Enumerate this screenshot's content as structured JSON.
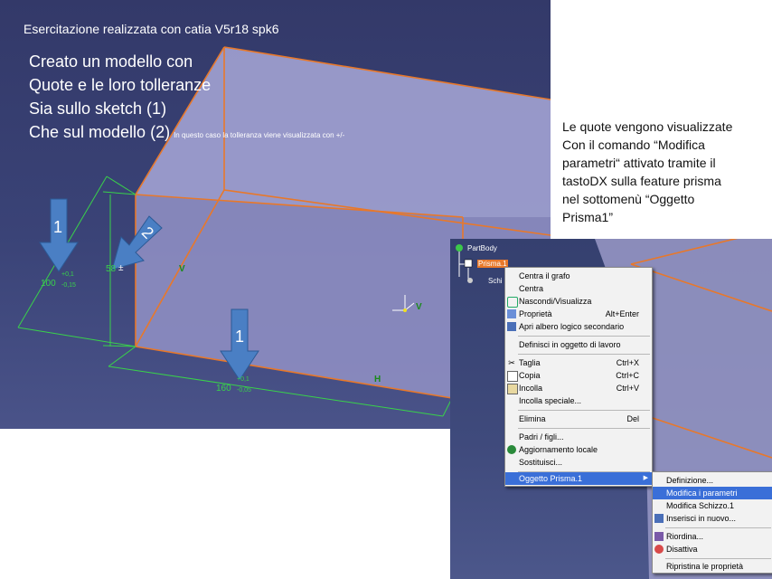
{
  "slide": {
    "title": "Esercitazione realizzata con catia  V5r18 spk6",
    "lines": [
      "Creato un modello con",
      "Quote e le loro tolleranze",
      "Sia sullo sketch (1)",
      "Che sul modello (2)"
    ],
    "note": "In questo caso la tolleranza viene visualizzata con +/-",
    "badges": [
      "1",
      "2",
      "1"
    ],
    "description": [
      "Le quote vengono visualizzate",
      "Con il comando “Modifica",
      "parametri“ attivato tramite il",
      "tastoDX sulla feature prisma",
      "nel sottomenù “Oggetto",
      "Prisma1”"
    ]
  },
  "dimensions": {
    "d100": {
      "value": "100",
      "plus": "+0,1",
      "minus": "-0,15"
    },
    "d58": {
      "value": "58",
      "sign": "±"
    },
    "d160": {
      "value": "160",
      "plus": "+0,1",
      "minus": "-0,05"
    }
  },
  "constraint_labels": {
    "v_left": "V",
    "h_bottom": "H",
    "h_right": "H",
    "v_axis": "V",
    "h_tree": "H"
  },
  "tree": {
    "root": "PartBody",
    "prism": "Prisma.1",
    "sketch": "Schi"
  },
  "context_menu": {
    "items": [
      {
        "label": "Centra il grafo",
        "shortcut": "",
        "icon": ""
      },
      {
        "label": "Centra",
        "shortcut": "",
        "icon": ""
      },
      {
        "label": "Nascondi/Visualizza",
        "shortcut": "",
        "icon": "eye-icon"
      },
      {
        "label": "Proprietà",
        "shortcut": "Alt+Enter",
        "icon": "properties-icon"
      },
      {
        "label": "Apri albero logico secondario",
        "shortcut": "",
        "icon": "tree-icon"
      },
      {
        "label": "Definisci in oggetto di lavoro",
        "shortcut": "",
        "icon": ""
      },
      {
        "label": "Taglia",
        "shortcut": "Ctrl+X",
        "icon": "scissors-icon"
      },
      {
        "label": "Copia",
        "shortcut": "Ctrl+C",
        "icon": "copy-icon"
      },
      {
        "label": "Incolla",
        "shortcut": "Ctrl+V",
        "icon": "paste-icon"
      },
      {
        "label": "Incolla speciale...",
        "shortcut": "",
        "icon": ""
      },
      {
        "label": "Elimina",
        "shortcut": "Del",
        "icon": ""
      },
      {
        "label": "Padri / figli...",
        "shortcut": "",
        "icon": ""
      },
      {
        "label": "Aggiornamento locale",
        "shortcut": "",
        "icon": "update-icon"
      },
      {
        "label": "Sostituisci...",
        "shortcut": "",
        "icon": ""
      },
      {
        "label": "Oggetto Prisma.1",
        "shortcut": "",
        "icon": ""
      }
    ]
  },
  "submenu": {
    "items": [
      {
        "label": "Definizione...",
        "icon": ""
      },
      {
        "label": "Modifica i parametri",
        "icon": ""
      },
      {
        "label": "Modifica Schizzo.1",
        "icon": ""
      },
      {
        "label": "Inserisci in nuovo...",
        "icon": "insert-icon"
      },
      {
        "label": "Riordina...",
        "icon": "reorder-icon"
      },
      {
        "label": "Disattiva",
        "icon": "deactivate-icon"
      },
      {
        "label": "Ripristina le proprietà",
        "icon": ""
      }
    ]
  },
  "colors": {
    "edge": "#e8782a",
    "dimension": "#39d24a",
    "arrow": "#4a7fc4",
    "highlight": "#3a6fd8",
    "tree_selected": "#e8782a"
  }
}
